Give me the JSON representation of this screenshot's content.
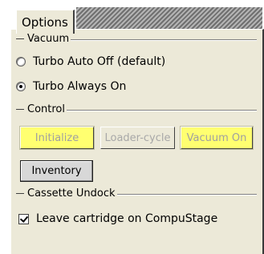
{
  "tab": {
    "label": "Options"
  },
  "vacuum": {
    "heading": "Vacuum",
    "options": [
      {
        "label": "Turbo Auto Off (default)",
        "selected": false
      },
      {
        "label": "Turbo Always On",
        "selected": true
      }
    ]
  },
  "control": {
    "heading": "Control",
    "buttons": {
      "initialize": "Initialize",
      "loader_cycle": "Loader-cycle",
      "vacuum_on": "Vacuum On",
      "inventory": "Inventory"
    }
  },
  "cassette": {
    "heading": "Cassette Undock",
    "leave_cartridge": {
      "label": "Leave cartridge on CompuStage",
      "checked": true
    }
  },
  "colors": {
    "panel": "#ece9d8",
    "yellow_button": "#ffff70",
    "tab_stripe_dark": "#707070",
    "tab_stripe_light": "#b4b4b4"
  }
}
